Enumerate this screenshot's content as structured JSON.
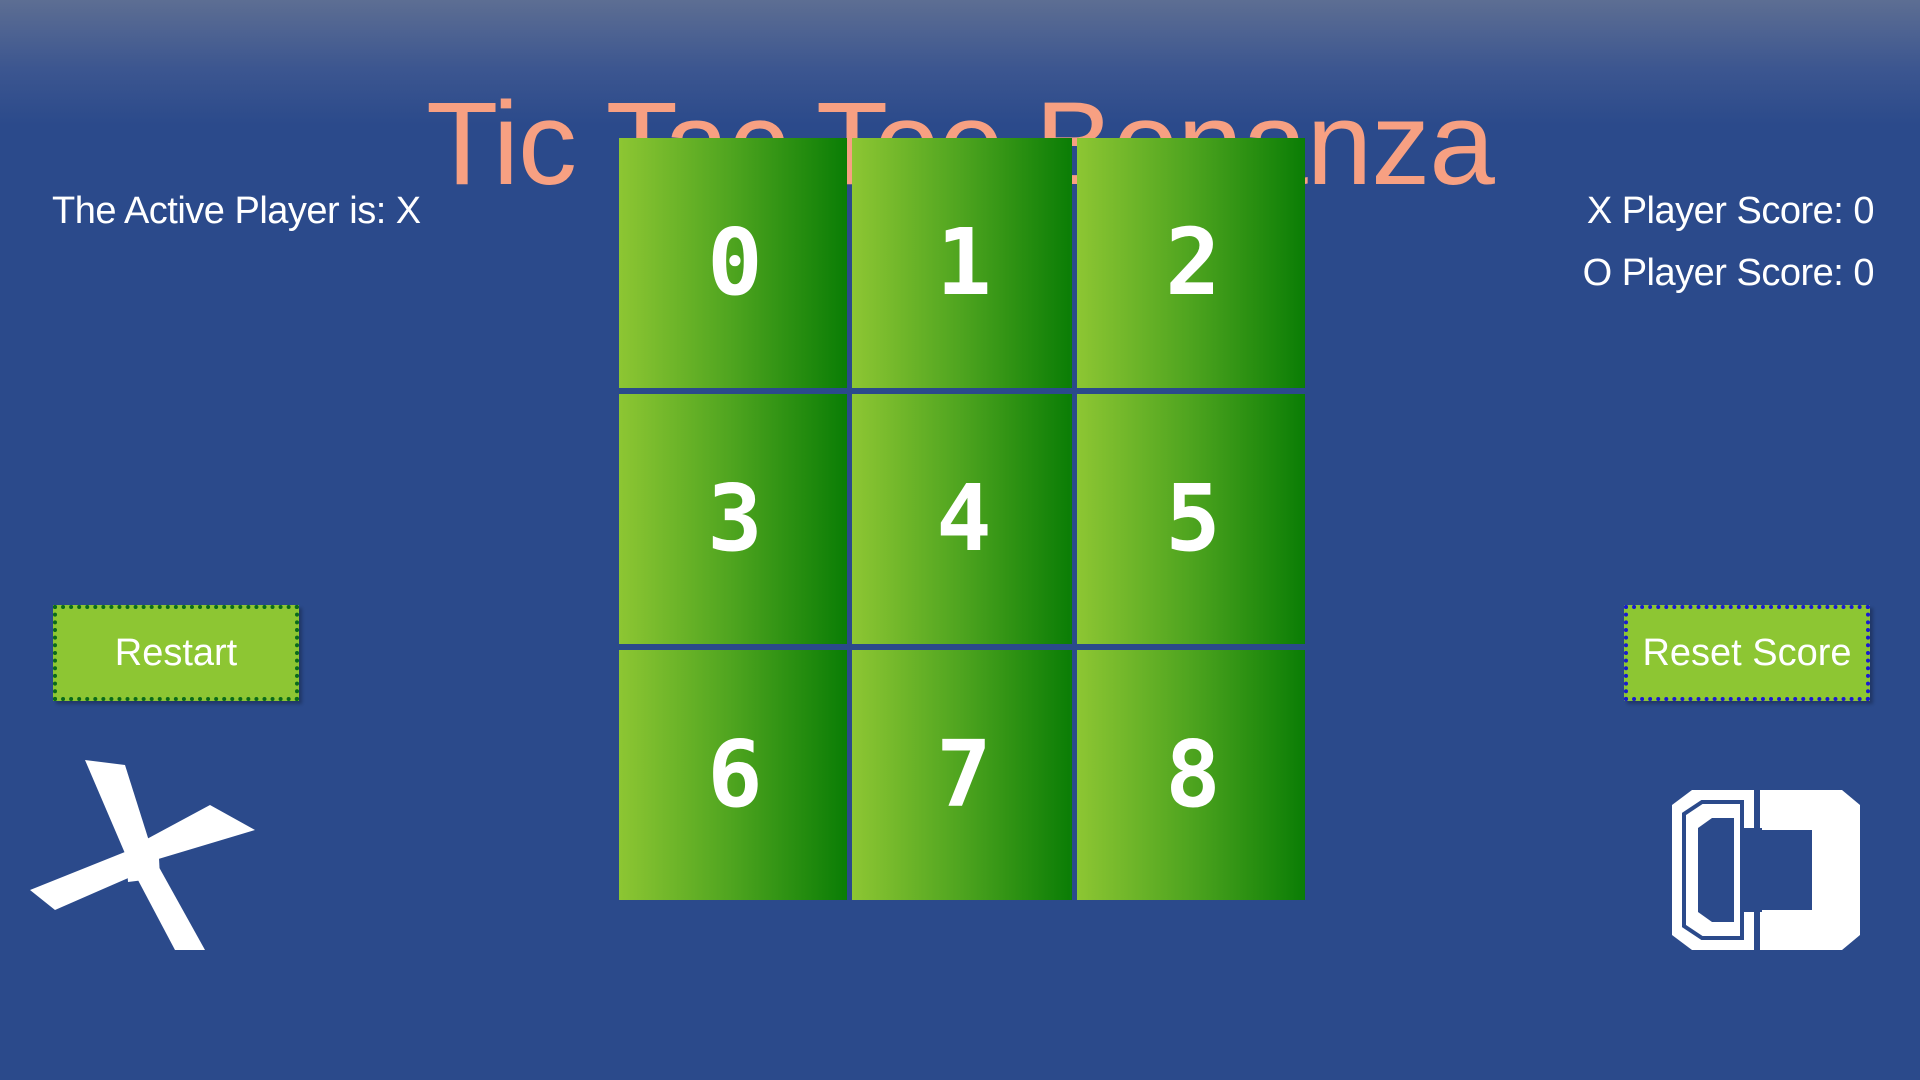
{
  "title": "Tic Tac Toe Bonanza",
  "status": {
    "active_player_text": "The Active Player is: X"
  },
  "scores": {
    "x_text": "X Player Score: 0",
    "o_text": "O Player Score: 0"
  },
  "board": {
    "cells": [
      "0",
      "1",
      "2",
      "3",
      "4",
      "5",
      "6",
      "7",
      "8"
    ]
  },
  "buttons": {
    "restart_label": "Restart",
    "reset_score_label": "Reset Score"
  },
  "colors": {
    "background": "#2b4a8b",
    "title": "#f7a082",
    "cell_light": "#8dc633",
    "cell_dark": "#0a7d05",
    "button": "#8dc633"
  },
  "icons": {
    "left": "x-icon",
    "right": "o-icon"
  }
}
